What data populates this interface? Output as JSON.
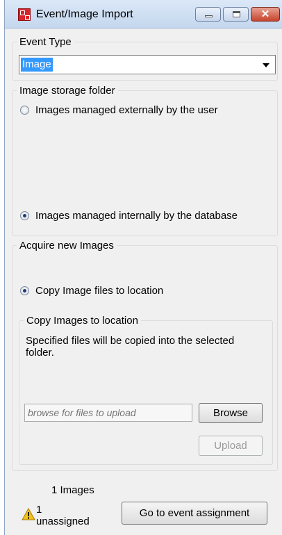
{
  "window": {
    "title": "Event/Image Import",
    "close_glyph": "✕"
  },
  "event_type": {
    "legend": "Event Type",
    "selected": "Image"
  },
  "storage": {
    "legend": "Image storage folder",
    "option_external": "Images managed externally by the user",
    "option_internal": "Images managed internally by the database",
    "selected": "internal"
  },
  "acquire": {
    "legend": "Acquire new Images",
    "option_copy": "Copy Image files to location",
    "copy_group": {
      "legend": "Copy Images to location",
      "description": "Specified files will be copied into the selected folder.",
      "path_placeholder": "browse for files to upload",
      "browse_label": "Browse",
      "upload_label": "Upload"
    }
  },
  "footer": {
    "images_count": "1 Images",
    "unassigned_count": "1",
    "unassigned_label": "unassigned",
    "assign_button": "Go to event assignment"
  },
  "icons": {
    "app": "app-icon",
    "warning": "warning-icon",
    "dropdown": "chevron-down-icon"
  },
  "colors": {
    "selection": "#3399ff",
    "window_bg": "#f0f0f0",
    "close_button": "#c7442c",
    "warning": "#f2c21b"
  }
}
